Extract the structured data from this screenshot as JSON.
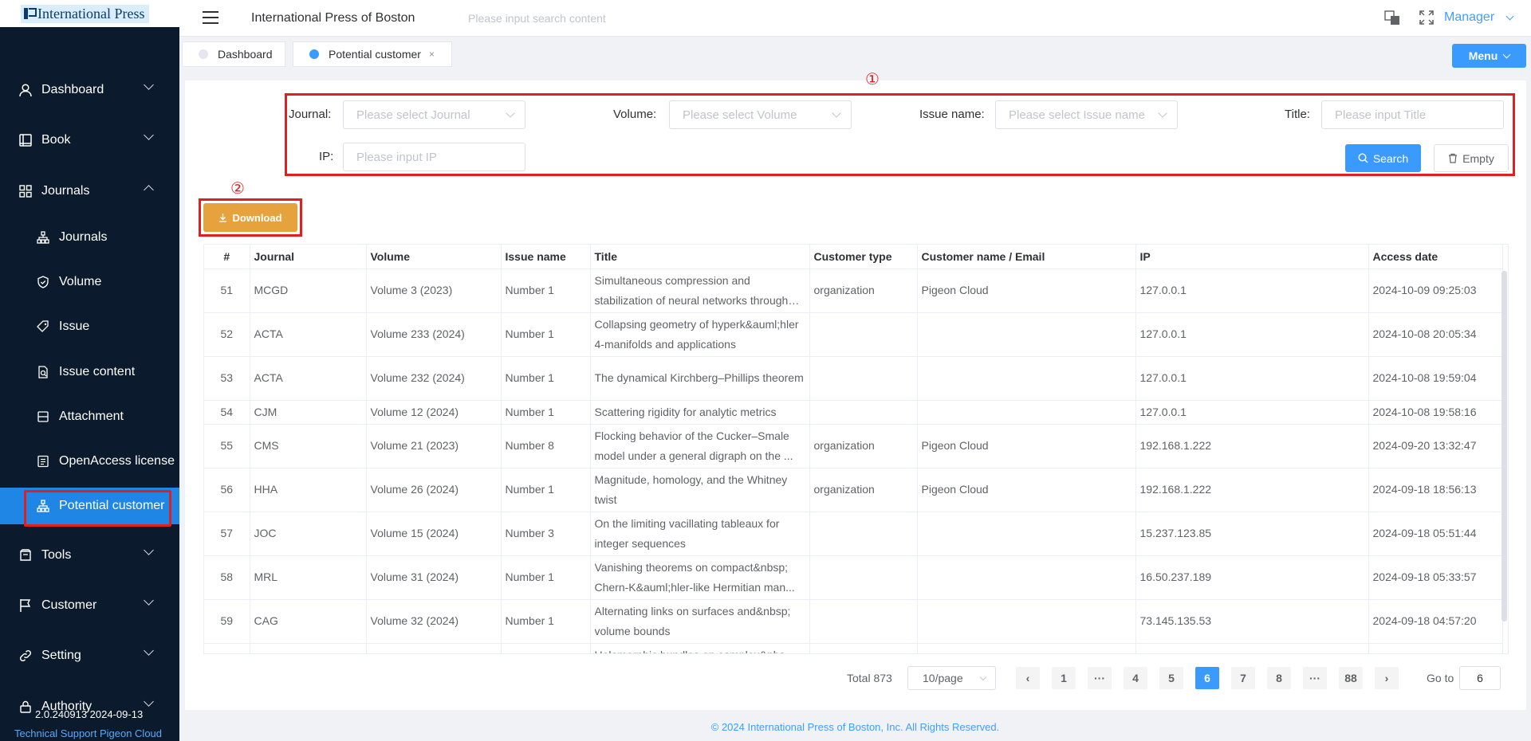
{
  "logo": {
    "text": "International Press"
  },
  "sidebar": {
    "items": [
      {
        "label": "Dashboard",
        "icon": "user-icon",
        "expanded": false
      },
      {
        "label": "Book",
        "icon": "book-icon",
        "expanded": false
      },
      {
        "label": "Journals",
        "icon": "grid-icon",
        "expanded": true
      },
      {
        "label": "Tools",
        "icon": "tools-icon",
        "expanded": false
      },
      {
        "label": "Customer",
        "icon": "flag-icon",
        "expanded": false
      },
      {
        "label": "Setting",
        "icon": "link-icon",
        "expanded": false
      },
      {
        "label": "Authority",
        "icon": "lock-icon",
        "expanded": false
      }
    ],
    "sub_items": [
      {
        "label": "Journals",
        "icon": "sitemap-icon"
      },
      {
        "label": "Volume",
        "icon": "shield-icon"
      },
      {
        "label": "Issue",
        "icon": "tag-icon"
      },
      {
        "label": "Issue content",
        "icon": "document-search-icon"
      },
      {
        "label": "Attachment",
        "icon": "archive-icon"
      },
      {
        "label": "OpenAccess license",
        "icon": "file-text-icon"
      },
      {
        "label": "Potential customer",
        "icon": "sitemap-icon",
        "active": true
      }
    ],
    "version": "2.0.240913 2024-09-13",
    "support": "Technical Support Pigeon Cloud"
  },
  "header": {
    "title": "International Press of Boston",
    "search_placeholder": "Please input search content",
    "user": "Manager"
  },
  "tabs": [
    {
      "label": "Dashboard",
      "active": false
    },
    {
      "label": "Potential customer",
      "active": true,
      "close": "×"
    }
  ],
  "menu_button": "Menu",
  "markers": {
    "filters": "①",
    "download": "②"
  },
  "filters": {
    "journal_label": "Journal:",
    "journal_placeholder": "Please select Journal",
    "volume_label": "Volume:",
    "volume_placeholder": "Please select Volume",
    "issue_label": "Issue name:",
    "issue_placeholder": "Please select Issue name",
    "title_label": "Title:",
    "title_placeholder": "Please input Title",
    "ip_label": "IP:",
    "ip_placeholder": "Please input IP",
    "search_button": "Search",
    "empty_button": "Empty"
  },
  "download_button": "Download",
  "table": {
    "columns": [
      "#",
      "Journal",
      "Volume",
      "Issue name",
      "Title",
      "Customer type",
      "Customer name / Email",
      "IP",
      "Access date"
    ],
    "rows": [
      [
        "51",
        "MCGD",
        "Volume 3 (2023)",
        "Number 1",
        "Simultaneous compression and stabilization of neural networks through pruning",
        "organization",
        "Pigeon Cloud",
        "127.0.0.1",
        "2024-10-09 09:25:03"
      ],
      [
        "52",
        "ACTA",
        "Volume 233 (2024)",
        "Number 1",
        "Collapsing geometry of hyperk&auml;hler 4-manifolds and applications",
        "",
        "",
        "127.0.0.1",
        "2024-10-08 20:05:34"
      ],
      [
        "53",
        "ACTA",
        "Volume 232 (2024)",
        "Number 1",
        "The dynamical Kirchberg–Phillips theorem",
        "",
        "",
        "127.0.0.1",
        "2024-10-08 19:59:04"
      ],
      [
        "54",
        "CJM",
        "Volume 12 (2024)",
        "Number 1",
        "Scattering rigidity for analytic metrics",
        "",
        "",
        "127.0.0.1",
        "2024-10-08 19:58:16"
      ],
      [
        "55",
        "CMS",
        "Volume 21 (2023)",
        "Number 8",
        "Flocking behavior of the Cucker–Smale model under a general digraph on the ...",
        "organization",
        "Pigeon Cloud",
        "192.168.1.222",
        "2024-09-20 13:32:47"
      ],
      [
        "56",
        "HHA",
        "Volume 26 (2024)",
        "Number 1",
        "Magnitude, homology, and the Whitney twist",
        "organization",
        "Pigeon Cloud",
        "192.168.1.222",
        "2024-09-18 18:56:13"
      ],
      [
        "57",
        "JOC",
        "Volume 15 (2024)",
        "Number 3",
        "On the limiting vacillating tableaux for integer sequences",
        "",
        "",
        "15.237.123.85",
        "2024-09-18 05:51:44"
      ],
      [
        "58",
        "MRL",
        "Volume 31 (2024)",
        "Number 1",
        "Vanishing theorems on compact&nbsp; Chern-K&auml;hler-like Hermitian man...",
        "",
        "",
        "16.50.237.189",
        "2024-09-18 05:33:57"
      ],
      [
        "59",
        "CAG",
        "Volume 32 (2024)",
        "Number 1",
        "Alternating links on surfaces and&nbsp; volume bounds",
        "",
        "",
        "73.145.135.53",
        "2024-09-18 04:57:20"
      ],
      [
        "",
        "",
        "",
        "",
        "Holomorphic bundles on complex&nbs",
        "",
        "",
        "",
        ""
      ]
    ]
  },
  "pagination": {
    "total": "Total 873",
    "page_size": "10/page",
    "pages": [
      "1",
      "···",
      "4",
      "5",
      "6",
      "7",
      "8",
      "···",
      "88"
    ],
    "current": "6",
    "prev": "‹",
    "next": "›",
    "goto_label": "Go to",
    "goto_value": "6"
  },
  "footer": "© 2024 International Press of Boston, Inc. All Rights Reserved.",
  "colors": {
    "sidebar_bg": "#0b1a2c",
    "active_item": "#1f86e6",
    "primary": "#3a9afd",
    "download": "#e6a23c",
    "highlight": "#e02020"
  }
}
